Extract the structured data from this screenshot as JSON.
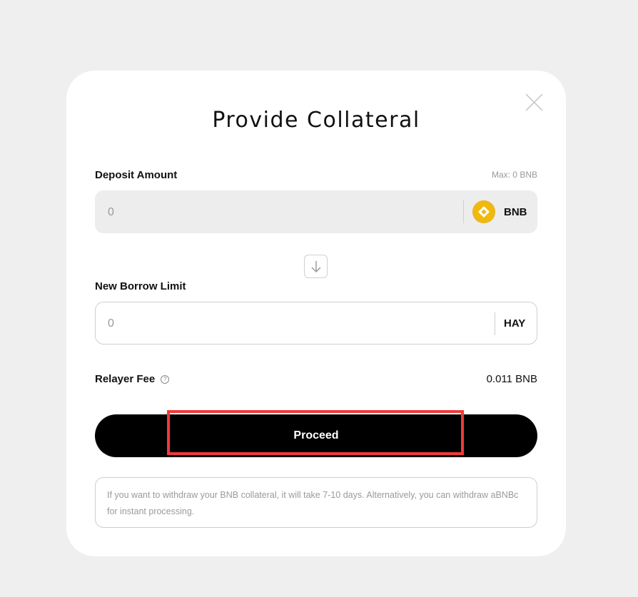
{
  "modal": {
    "title": "Provide Collateral"
  },
  "deposit": {
    "label": "Deposit Amount",
    "max": "Max: 0 BNB",
    "placeholder": "0",
    "token": "BNB",
    "token_icon": "bnb-icon",
    "token_color": "#f0b90b"
  },
  "borrow": {
    "label": "New Borrow Limit",
    "placeholder": "0",
    "token": "HAY"
  },
  "fee": {
    "label": "Relayer Fee",
    "value": "0.011 BNB",
    "help_glyph": "?"
  },
  "actions": {
    "proceed_label": "Proceed",
    "highlight_color": "#f03a3a"
  },
  "note": {
    "text": "If you want to withdraw your BNB collateral, it will take 7-10 days. Alternatively, you can withdraw aBNBc for instant processing."
  }
}
